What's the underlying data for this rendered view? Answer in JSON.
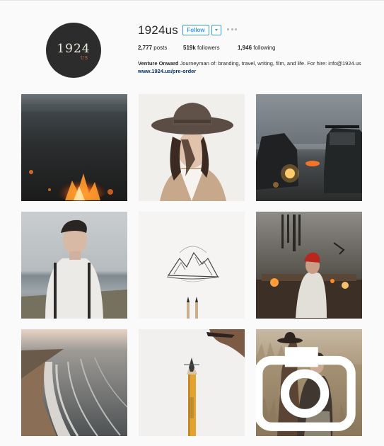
{
  "profile": {
    "username": "1924us",
    "avatar_text": "1924",
    "avatar_subtext": "US",
    "follow_label": "Follow",
    "stats": {
      "posts_count": "2,777",
      "posts_label": "posts",
      "followers_count": "519k",
      "followers_label": "followers",
      "following_count": "1,946",
      "following_label": "following"
    },
    "bio": {
      "name": "Venture Onward",
      "text": " Journeyman of: branding, travel, writing, film, and life. For hire: info@1924.us ",
      "link": "www.1924.us/pre-order"
    }
  },
  "posts": [
    {
      "icon": "campfire-photo"
    },
    {
      "icon": "woman-hat-photo"
    },
    {
      "icon": "trucks-beach-photo"
    },
    {
      "icon": "man-suspenders-photo"
    },
    {
      "icon": "pencil-drawing-photo"
    },
    {
      "icon": "workshop-photo"
    },
    {
      "icon": "coastline-photo"
    },
    {
      "icon": "pencil-carving-photo"
    },
    {
      "icon": "grass-portrait-photo",
      "badge": "camera-icon"
    }
  ],
  "colors": {
    "accent": "#3897f0",
    "background": "#fafafa",
    "link": "#003569"
  }
}
